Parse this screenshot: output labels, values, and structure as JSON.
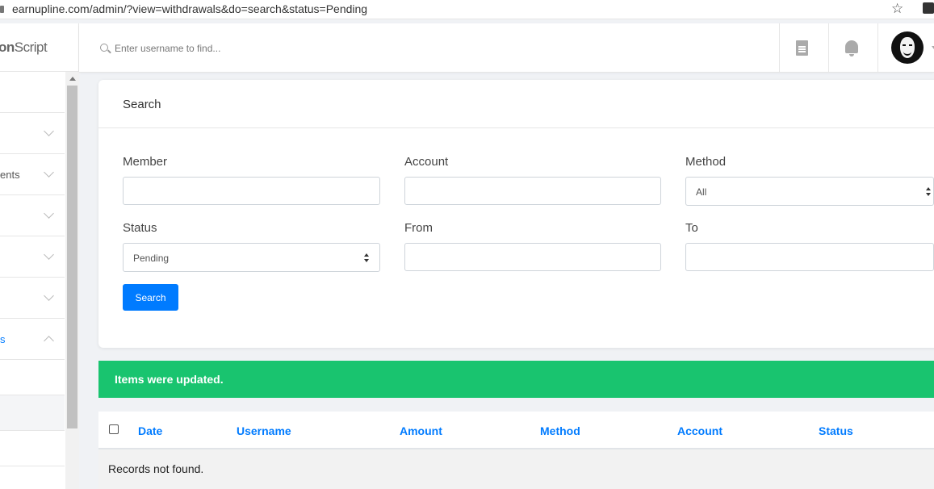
{
  "browser": {
    "url": "earnupline.com/admin/?view=withdrawals&do=search&status=Pending"
  },
  "sidebar": {
    "brand_prefix": "on",
    "brand_suffix": "Script",
    "items": [
      {
        "label": ""
      },
      {
        "label": ""
      },
      {
        "label": "ents"
      },
      {
        "label": ""
      },
      {
        "label": ""
      },
      {
        "label": ""
      },
      {
        "label": "s"
      },
      {
        "label": ""
      },
      {
        "label": ""
      },
      {
        "label": ""
      }
    ]
  },
  "header": {
    "search_placeholder": "Enter username to find..."
  },
  "search_card": {
    "title": "Search",
    "member_label": "Member",
    "member_value": "",
    "account_label": "Account",
    "account_value": "",
    "method_label": "Method",
    "method_value": "All",
    "status_label": "Status",
    "status_value": "Pending",
    "from_label": "From",
    "from_value": "",
    "to_label": "To",
    "to_value": "",
    "button_label": "Search"
  },
  "alert": {
    "message": "Items were updated.",
    "color": "#19c46f"
  },
  "table": {
    "columns": [
      "Date",
      "Username",
      "Amount",
      "Method",
      "Account",
      "Status"
    ],
    "empty_message": "Records not found."
  },
  "colors": {
    "accent": "#007bff",
    "success": "#19c46f"
  }
}
